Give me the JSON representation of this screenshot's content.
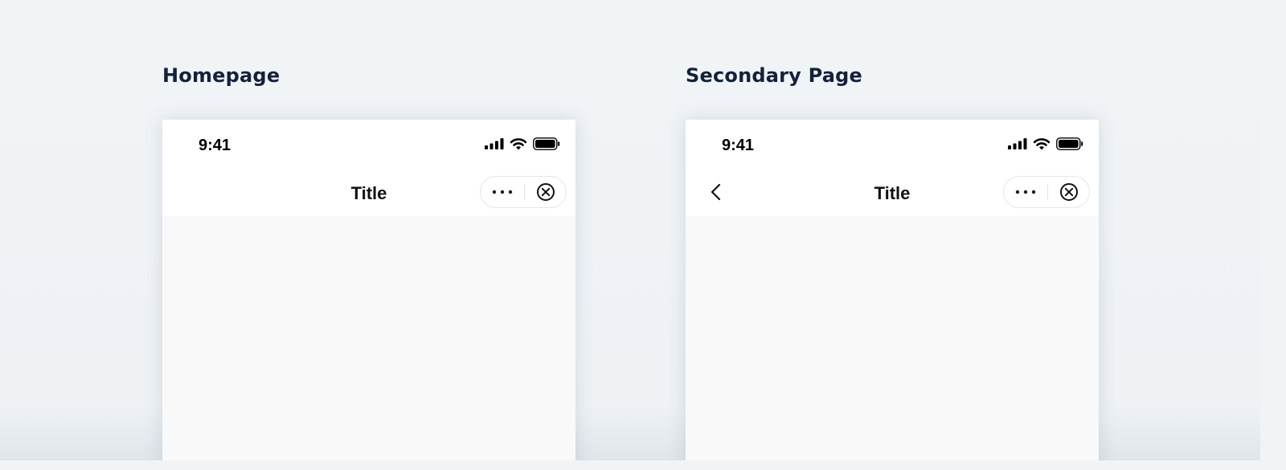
{
  "panels": [
    {
      "heading": "Homepage",
      "status_time": "9:41",
      "nav_title": "Title",
      "has_back": false
    },
    {
      "heading": "Secondary Page",
      "status_time": "9:41",
      "nav_title": "Title",
      "has_back": true
    }
  ],
  "icons": {
    "signal": "cellular-signal-icon",
    "wifi": "wifi-icon",
    "battery": "battery-icon",
    "more": "more-dots-icon",
    "close": "close-circle-icon",
    "back": "chevron-left-icon"
  },
  "colors": {
    "background": "#f0f4f7",
    "heading": "#14213a",
    "bar": "#ffffff",
    "content": "#f9f9f9"
  }
}
